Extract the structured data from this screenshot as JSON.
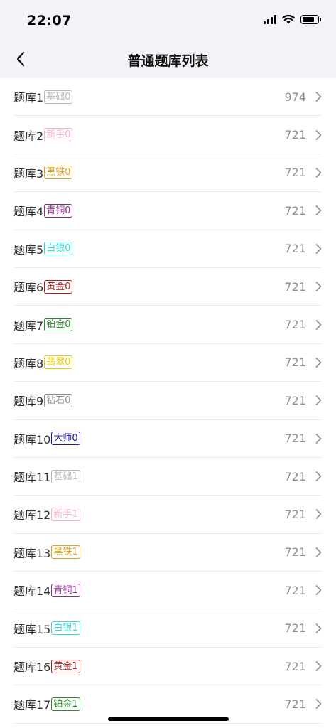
{
  "status": {
    "time": "22:07"
  },
  "header": {
    "title": "普通题库列表"
  },
  "rows": [
    {
      "name": "题库1",
      "tag": "基础0",
      "color": "#b8b8b8",
      "count": "974"
    },
    {
      "name": "题库2",
      "tag": "新手0",
      "color": "#f5b4c8",
      "count": "721"
    },
    {
      "name": "题库3",
      "tag": "黑铁0",
      "color": "#e6a01c",
      "count": "721"
    },
    {
      "name": "题库4",
      "tag": "青铜0",
      "color": "#8a2a8a",
      "count": "721"
    },
    {
      "name": "题库5",
      "tag": "白银0",
      "color": "#3ed8d8",
      "count": "721"
    },
    {
      "name": "题库6",
      "tag": "黄金0",
      "color": "#a62121",
      "count": "721"
    },
    {
      "name": "题库7",
      "tag": "铂金0",
      "color": "#2b8a2b",
      "count": "721"
    },
    {
      "name": "题库8",
      "tag": "翡翠0",
      "color": "#e6cc12",
      "count": "721"
    },
    {
      "name": "题库9",
      "tag": "钻石0",
      "color": "#8c8c8c",
      "count": "721"
    },
    {
      "name": "题库10",
      "tag": "大师0",
      "color": "#1c1ca6",
      "count": "721"
    },
    {
      "name": "题库11",
      "tag": "基础1",
      "color": "#b8b8b8",
      "count": "721"
    },
    {
      "name": "题库12",
      "tag": "新手1",
      "color": "#f5b4c8",
      "count": "721"
    },
    {
      "name": "题库13",
      "tag": "黑铁1",
      "color": "#e6a01c",
      "count": "721"
    },
    {
      "name": "题库14",
      "tag": "青铜1",
      "color": "#8a2a8a",
      "count": "721"
    },
    {
      "name": "题库15",
      "tag": "白银1",
      "color": "#3ed8d8",
      "count": "721"
    },
    {
      "name": "题库16",
      "tag": "黄金1",
      "color": "#a62121",
      "count": "721"
    },
    {
      "name": "题库17",
      "tag": "铂金1",
      "color": "#2b8a2b",
      "count": "721"
    }
  ]
}
